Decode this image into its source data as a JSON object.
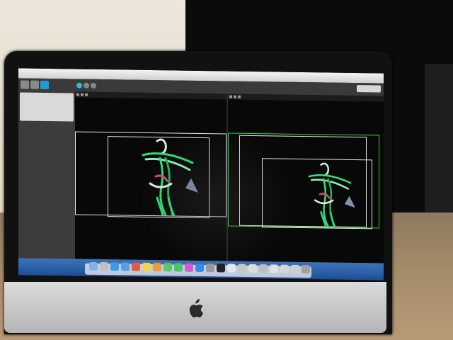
{
  "scene": {
    "monitor_brand": "apple-logo-icon"
  },
  "app": {
    "toolbar": {
      "buttons": [
        "grid-icon",
        "layers-icon",
        "target-icon"
      ],
      "view_controls": [
        "view-toggle-1",
        "view-toggle-2",
        "view-toggle-3"
      ]
    },
    "sidebar": {
      "lines": [
        "",
        "",
        "",
        "",
        "",
        ""
      ]
    },
    "views": {
      "left": {
        "has_green_frame": false
      },
      "right": {
        "has_green_frame": true
      }
    }
  },
  "colors": {
    "accent": "#1e9bd7",
    "selection_frame": "#2fd24a",
    "cloud_green": "#2fe07a",
    "dock_blue": "#2a5fa6"
  },
  "dock": {
    "icons": [
      "finder-icon",
      "launchpad-icon",
      "safari-icon",
      "mail-icon",
      "calendar-icon",
      "notes-icon",
      "photos-icon",
      "messages-icon",
      "facetime-icon",
      "itunes-icon",
      "appstore-icon",
      "settings-icon",
      "terminal-icon",
      "app-icon",
      "app-icon",
      "app-icon",
      "app-icon",
      "app-icon",
      "app-icon",
      "app-icon",
      "trash-icon"
    ]
  }
}
